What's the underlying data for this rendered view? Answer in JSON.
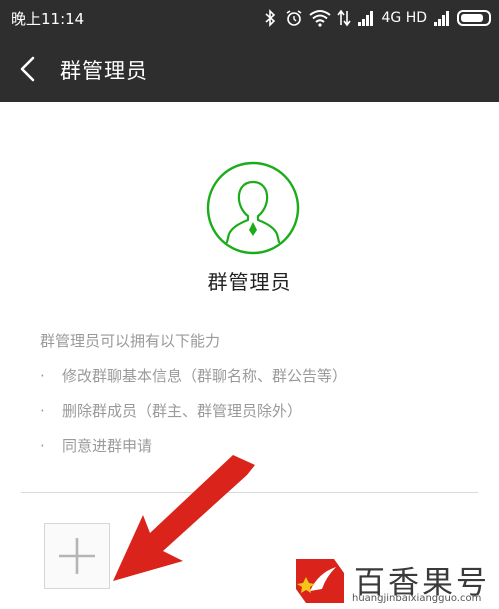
{
  "status_bar": {
    "time": "晚上11:14",
    "network": "4G HD",
    "icons": [
      "bluetooth-icon",
      "alarm-icon",
      "wifi-icon",
      "data-arrows-icon",
      "signal-icon",
      "signal-icon",
      "battery-icon"
    ],
    "battery_level": 0.85
  },
  "nav": {
    "back_icon": "chevron-left-icon",
    "title": "群管理员"
  },
  "admin": {
    "icon": "user-silhouette-icon",
    "accent_color": "#1aad19",
    "title": "群管理员"
  },
  "description": {
    "heading": "群管理员可以拥有以下能力",
    "items": [
      "修改群聊基本信息（群聊名称、群公告等）",
      "删除群成员（群主、群管理员除外）",
      "同意进群申请"
    ],
    "bullet": "·"
  },
  "add_button": {
    "icon": "plus-icon"
  },
  "annotation": {
    "color": "#d9231b",
    "icon": "arrow-pointer-icon"
  },
  "watermark": {
    "text": "百香果号",
    "url": "huangjinbaixiangguo.com",
    "logo_color": "#d9231b"
  }
}
